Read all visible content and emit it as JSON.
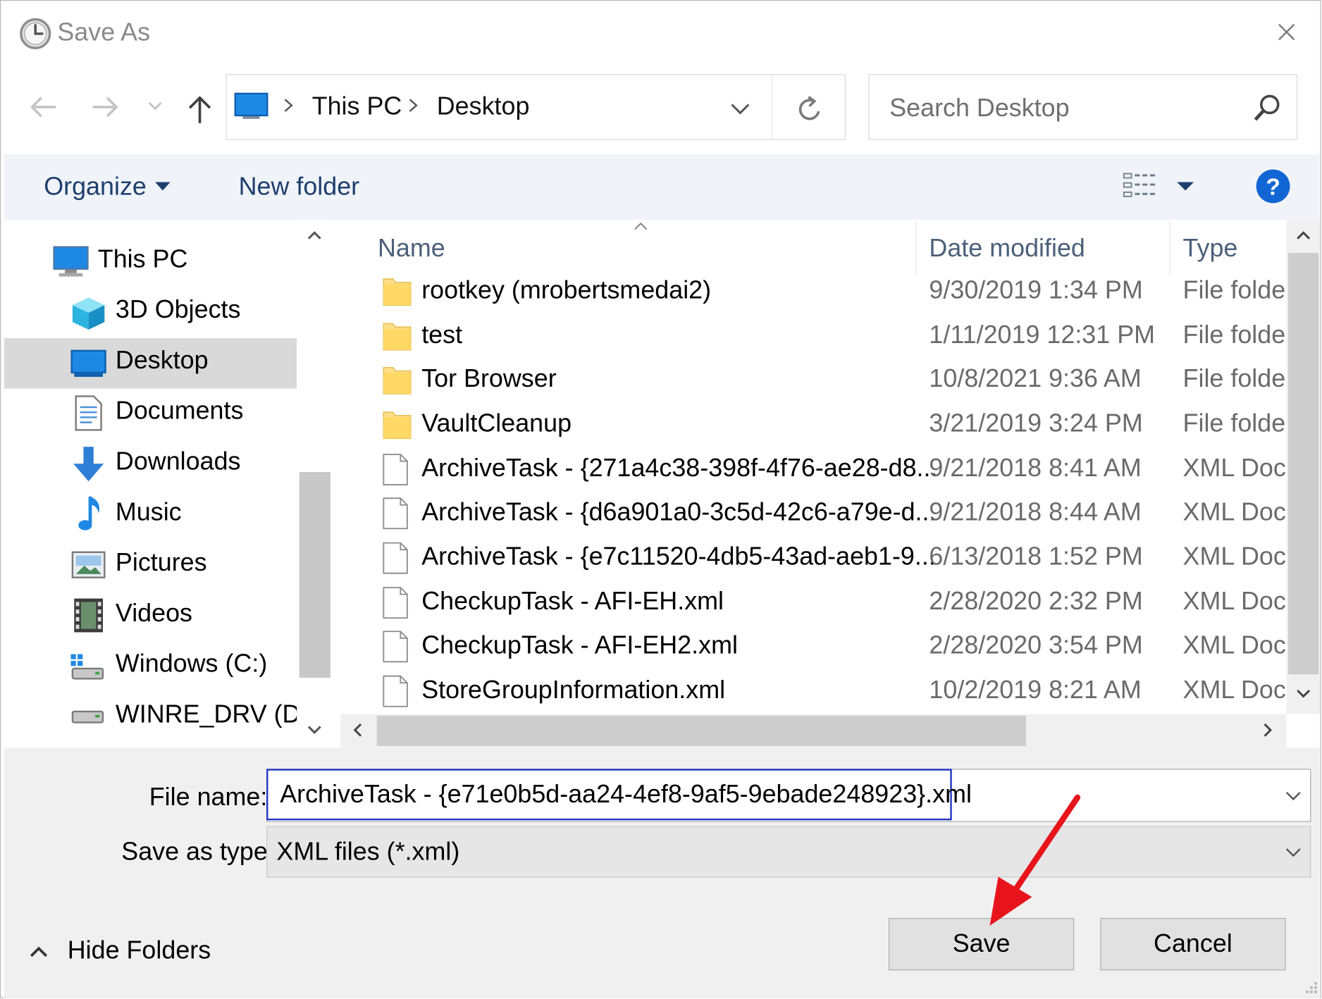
{
  "window": {
    "title": "Save As"
  },
  "address": {
    "crumbs": [
      "This PC",
      "Desktop"
    ]
  },
  "search": {
    "placeholder": "Search Desktop"
  },
  "toolbar": {
    "organize": "Organize",
    "new_folder": "New folder"
  },
  "nav": {
    "items": [
      {
        "label": "This PC",
        "icon": "computer-icon"
      },
      {
        "label": "3D Objects",
        "icon": "cube-icon"
      },
      {
        "label": "Desktop",
        "icon": "desktop-icon",
        "selected": true
      },
      {
        "label": "Documents",
        "icon": "documents-icon"
      },
      {
        "label": "Downloads",
        "icon": "download-icon"
      },
      {
        "label": "Music",
        "icon": "music-icon"
      },
      {
        "label": "Pictures",
        "icon": "pictures-icon"
      },
      {
        "label": "Videos",
        "icon": "videos-icon"
      },
      {
        "label": "Windows (C:)",
        "icon": "drive-icon"
      },
      {
        "label": "WINRE_DRV (D:)",
        "icon": "drive-icon"
      }
    ]
  },
  "list": {
    "columns": {
      "name": "Name",
      "date": "Date modified",
      "type": "Type"
    },
    "rows": [
      {
        "name": "rootkey (mrobertsmedai2)",
        "date": "9/30/2019 1:34 PM",
        "type": "File folder",
        "kind": "folder"
      },
      {
        "name": "test",
        "date": "1/11/2019 12:31 PM",
        "type": "File folder",
        "kind": "folder"
      },
      {
        "name": "Tor Browser",
        "date": "10/8/2021 9:36 AM",
        "type": "File folder",
        "kind": "folder"
      },
      {
        "name": "VaultCleanup",
        "date": "3/21/2019 3:24 PM",
        "type": "File folder",
        "kind": "folder"
      },
      {
        "name": "ArchiveTask - {271a4c38-398f-4f76-ae28-d8...",
        "date": "9/21/2018 8:41 AM",
        "type": "XML Document",
        "kind": "file"
      },
      {
        "name": "ArchiveTask - {d6a901a0-3c5d-42c6-a79e-d...",
        "date": "9/21/2018 8:44 AM",
        "type": "XML Document",
        "kind": "file"
      },
      {
        "name": "ArchiveTask - {e7c11520-4db5-43ad-aeb1-9...",
        "date": "6/13/2018 1:52 PM",
        "type": "XML Document",
        "kind": "file"
      },
      {
        "name": "CheckupTask - AFI-EH.xml",
        "date": "2/28/2020 2:32 PM",
        "type": "XML Document",
        "kind": "file"
      },
      {
        "name": "CheckupTask - AFI-EH2.xml",
        "date": "2/28/2020 3:54 PM",
        "type": "XML Document",
        "kind": "file"
      },
      {
        "name": "StoreGroupInformation.xml",
        "date": "10/2/2019 8:21 AM",
        "type": "XML Document",
        "kind": "file"
      }
    ]
  },
  "form": {
    "file_name_label": "File name:",
    "file_name_value": "ArchiveTask - {e71e0b5d-aa24-4ef8-9af5-9ebade248923}.xml",
    "save_type_label": "Save as type:",
    "save_type_value": "XML files (*.xml)"
  },
  "buttons": {
    "save": "Save",
    "cancel": "Cancel",
    "hide_folders": "Hide Folders"
  },
  "colors": {
    "accent": "#2135c7",
    "annotation_arrow": "#e8141b",
    "help": "#1266d4"
  }
}
